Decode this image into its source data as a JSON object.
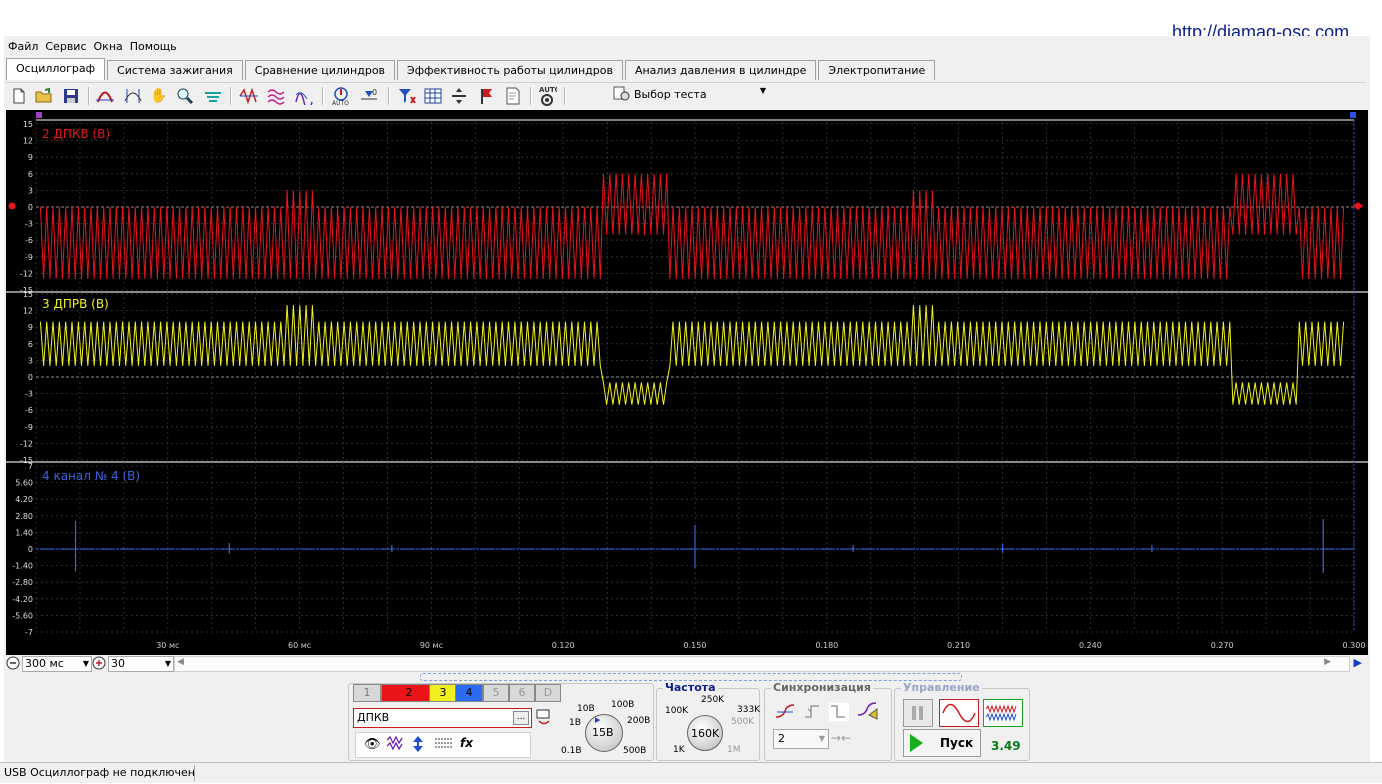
{
  "site_url": "http://diamag-osc.com",
  "menu": [
    "Файл",
    "Сервис",
    "Окна",
    "Помощь"
  ],
  "tabs": [
    "Осциллограф",
    "Система зажигания",
    "Сравнение цилиндров",
    "Эффективность работы цилиндров",
    "Анализ давления в цилиндре",
    "Электропитание"
  ],
  "active_tab": "Осциллограф",
  "toolbar": {
    "icons": [
      "new-file-icon",
      "open-folder-icon",
      "save-icon",
      "cursor-measure-icon",
      "cursor-vertical-icon",
      "hand-pan-icon",
      "zoom-icon",
      "signal-filter-icon",
      "spectrum-icon",
      "overlay-icon",
      "sweep-icon",
      "auto-sync-icon",
      "zero-level-icon",
      "channel-filter-icon",
      "table-icon",
      "split-icon",
      "flag-icon",
      "report-icon",
      "auto-test-icon"
    ],
    "auto_label": "AUTO",
    "test_select_label": "Выбор теста"
  },
  "channels": [
    {
      "label": "2 ДПКВ (В)",
      "color": "#e8141c",
      "yticks": [
        "15",
        "12",
        "9",
        "6",
        "3",
        "0",
        "-3",
        "-6",
        "-9",
        "-12",
        "-15"
      ]
    },
    {
      "label": "3 ДПРВ (В)",
      "color": "#f2f21a",
      "yticks": [
        "15",
        "12",
        "9",
        "6",
        "3",
        "0",
        "-3",
        "-6",
        "-9",
        "-12",
        "-15"
      ]
    },
    {
      "label": "4 канал № 4 (В)",
      "color": "#3c64dc",
      "yticks": [
        "7",
        "5.60",
        "4.20",
        "2.80",
        "1.40",
        "0",
        "-1.40",
        "-2.80",
        "-4.20",
        "-5.60",
        "-7"
      ]
    }
  ],
  "time_axis": {
    "labels": [
      "30 мс",
      "60 мс",
      "90 мс",
      "0.120",
      "0.150",
      "0.180",
      "0.210",
      "0.240",
      "0.270",
      "0.300"
    ],
    "range_s": [
      0,
      0.3
    ]
  },
  "bottom_controls": {
    "timebase": "300 мс",
    "points": "30"
  },
  "channel_panel": {
    "buttons": [
      "1",
      "2",
      "3",
      "4",
      "5",
      "6",
      "D"
    ],
    "active": "2",
    "sensor_name": "ДПКВ",
    "dots_button": "...",
    "voltage_scale": {
      "labels": [
        "0.1В",
        "1В",
        "10В",
        "100В",
        "200В",
        "500В"
      ],
      "value": "15В"
    }
  },
  "frequency_panel": {
    "title": "Частота",
    "labels": [
      "1K",
      "100K",
      "250K",
      "333K",
      "500K",
      "1M"
    ],
    "value": "160K"
  },
  "sync_panel": {
    "title": "Синхронизация",
    "channel": "2"
  },
  "control_panel": {
    "title": "Управление",
    "start_label": "Пуск",
    "value": "3.49"
  },
  "status": "USB Осциллограф не подключен"
}
